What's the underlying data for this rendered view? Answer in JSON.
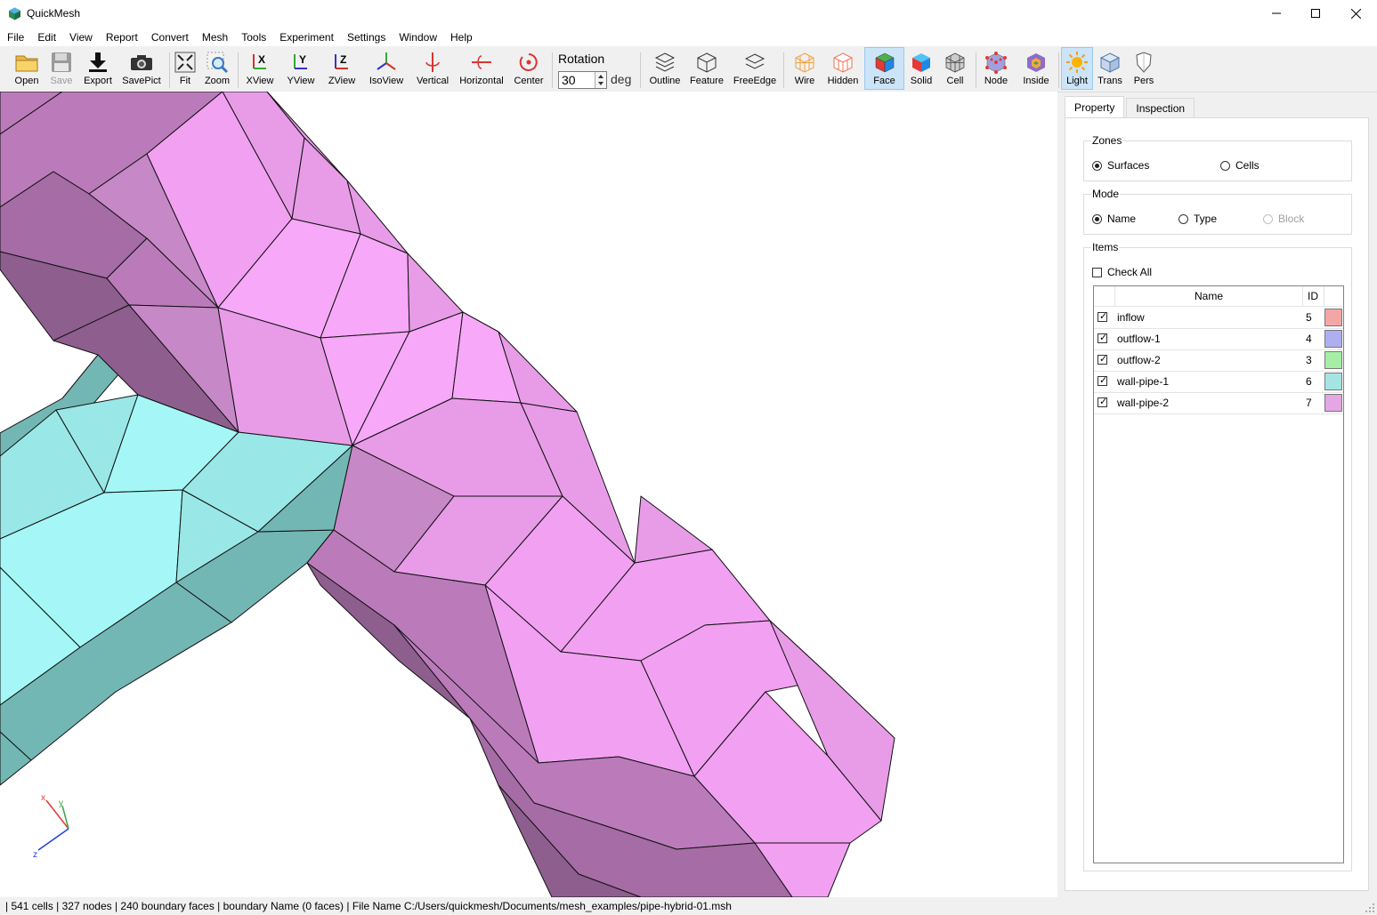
{
  "window": {
    "title": "QuickMesh",
    "minimize": "—",
    "maximize": "☐",
    "close": "✕"
  },
  "menu": [
    "File",
    "Edit",
    "View",
    "Report",
    "Convert",
    "Mesh",
    "Tools",
    "Experiment",
    "Settings",
    "Window",
    "Help"
  ],
  "toolbar": {
    "open": "Open",
    "save": "Save",
    "export": "Export",
    "savepict": "SavePict",
    "fit": "Fit",
    "zoom": "Zoom",
    "xview": "XView",
    "yview": "YView",
    "zview": "ZView",
    "isoview": "IsoView",
    "vertical": "Vertical",
    "horizontal": "Horizontal",
    "center": "Center",
    "rotation_label": "Rotation",
    "rotation_value": "30",
    "rotation_unit": "deg",
    "outline": "Outline",
    "feature": "Feature",
    "freeedge": "FreeEdge",
    "wire": "Wire",
    "hidden": "Hidden",
    "face": "Face",
    "solid": "Solid",
    "cell": "Cell",
    "node": "Node",
    "inside": "Inside",
    "light": "Light",
    "trans": "Trans",
    "pers": "Pers"
  },
  "axes": {
    "x": "x",
    "y": "y",
    "z": "z"
  },
  "panel": {
    "tabs": [
      "Property",
      "Inspection"
    ],
    "zones": {
      "title": "Zones",
      "surfaces": "Surfaces",
      "cells": "Cells",
      "selected": "Surfaces"
    },
    "mode": {
      "title": "Mode",
      "name": "Name",
      "type": "Type",
      "block": "Block",
      "selected": "Name"
    },
    "items": {
      "title": "Items",
      "check_all": "Check All",
      "columns": {
        "name": "Name",
        "id": "ID"
      },
      "rows": [
        {
          "name": "inflow",
          "id": "5",
          "checked": true,
          "color": "#f4a6a6"
        },
        {
          "name": "outflow-1",
          "id": "4",
          "checked": true,
          "color": "#aeaef0"
        },
        {
          "name": "outflow-2",
          "id": "3",
          "checked": true,
          "color": "#a6eea6"
        },
        {
          "name": "wall-pipe-1",
          "id": "6",
          "checked": true,
          "color": "#a6e4e4"
        },
        {
          "name": "wall-pipe-2",
          "id": "7",
          "checked": true,
          "color": "#e4a6e4"
        }
      ]
    }
  },
  "status": "| 541 cells | 327 nodes | 240 boundary faces |  boundary Name  (0 faces) | File Name C:/Users/quickmesh/Documents/mesh_examples/pipe-hybrid-01.msh"
}
